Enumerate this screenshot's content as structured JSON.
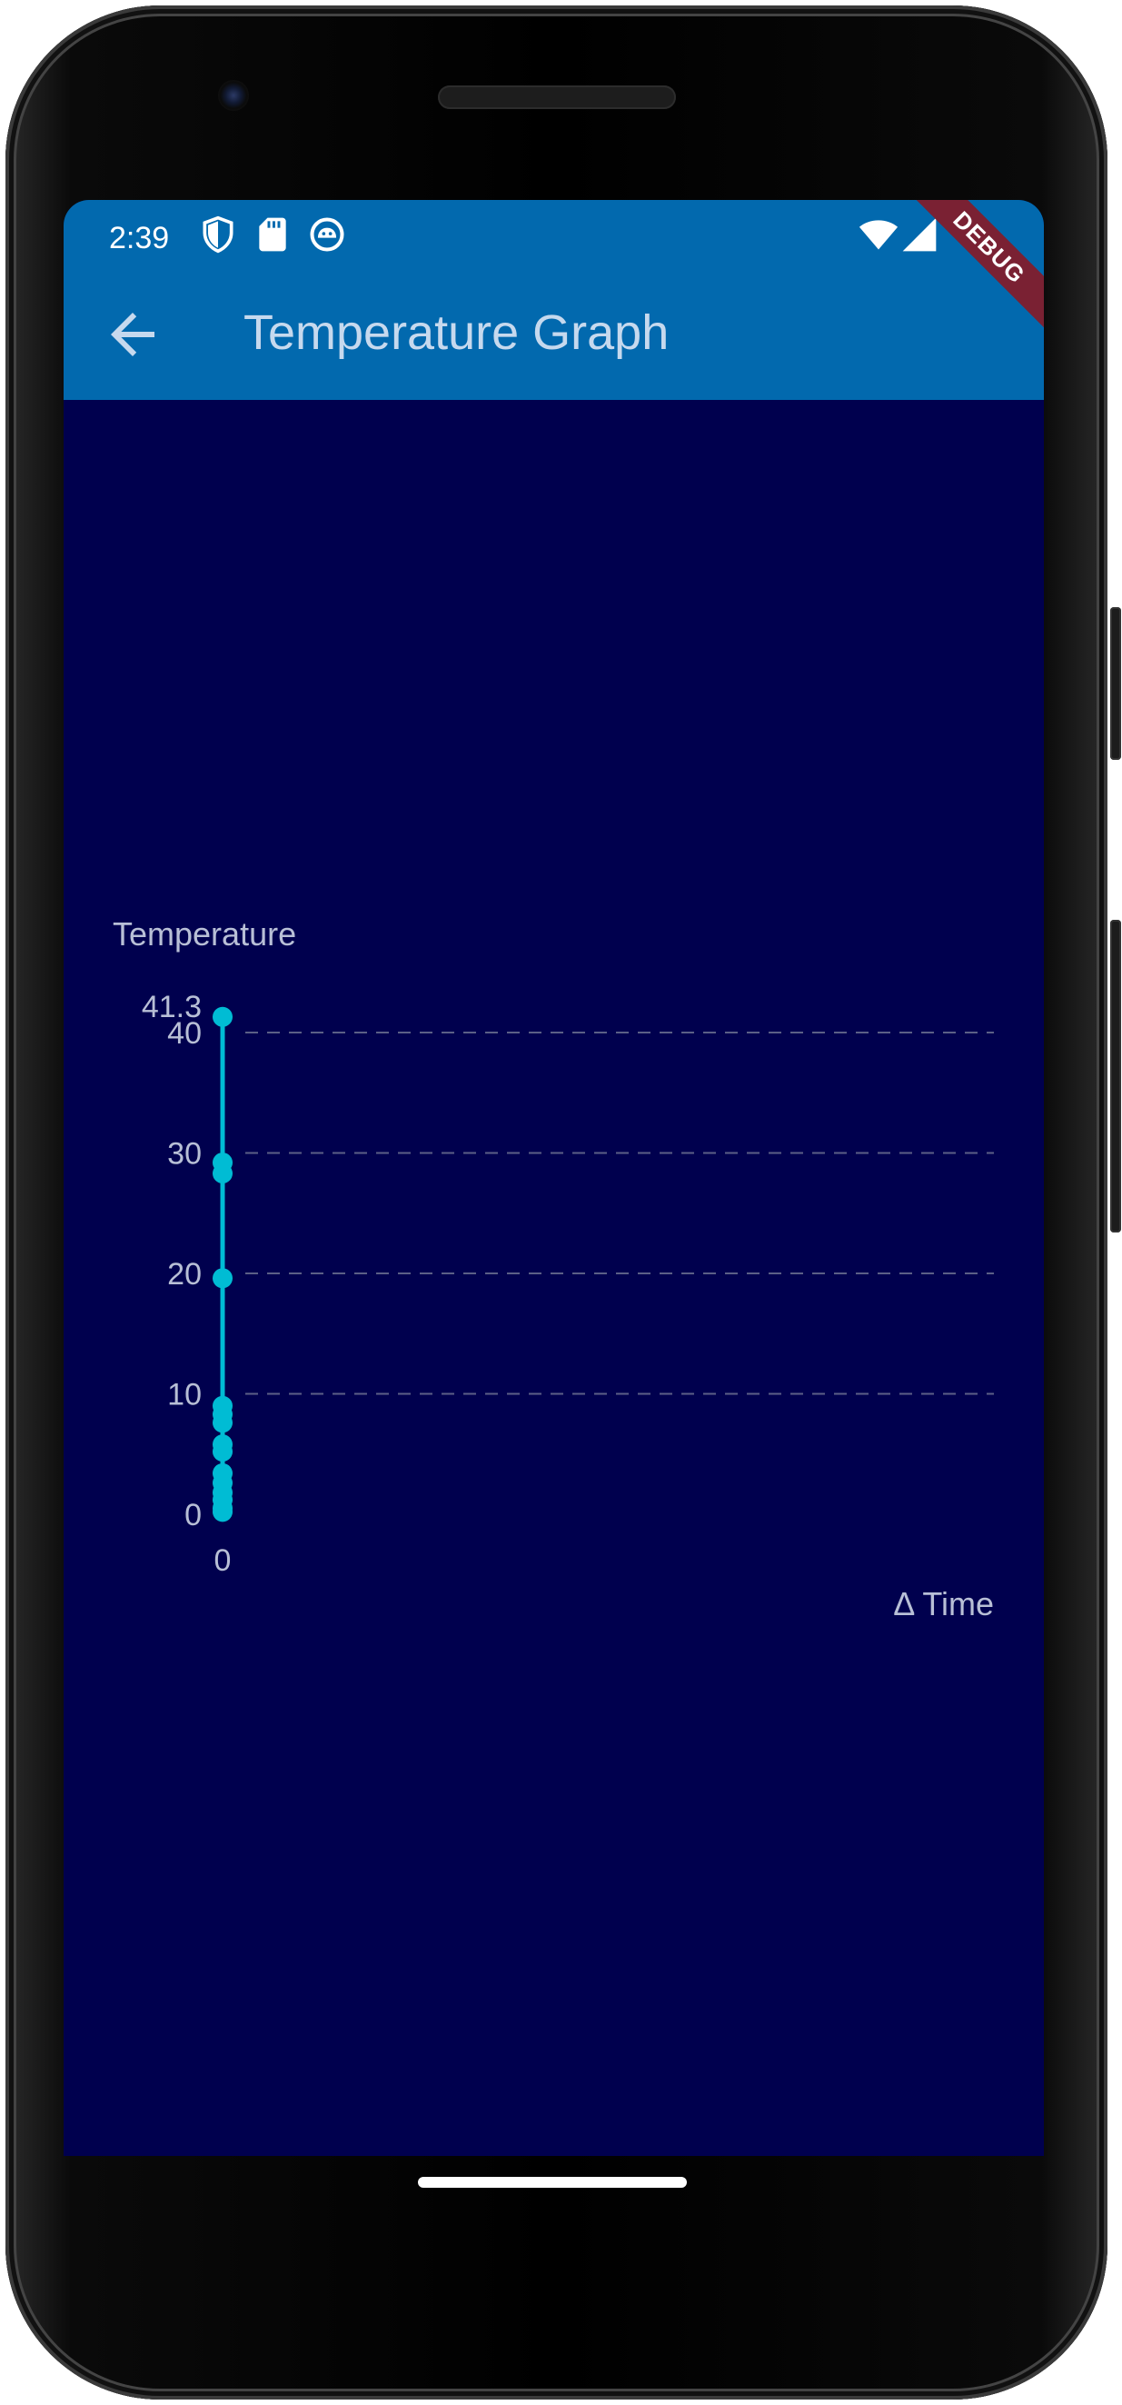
{
  "status_bar": {
    "time": "2:39",
    "icons_left": [
      "shield-icon",
      "sd-card-icon",
      "android-debug-icon"
    ],
    "icons_right": [
      "wifi-icon",
      "cell-signal-icon"
    ]
  },
  "app_bar": {
    "back_icon": "arrow-back-icon",
    "title": "Temperature Graph",
    "background": "#0269ae"
  },
  "debug_banner": {
    "label": "DEBUG",
    "color": "#7a2133"
  },
  "screen_background": "#00004e",
  "chart_data": {
    "type": "line",
    "ylabel": "Temperature",
    "xlabel": "Δ Time",
    "y_ticks": [
      "0",
      "10",
      "20",
      "30",
      "40"
    ],
    "y_max_label": "41.3",
    "x_ticks": [
      "0"
    ],
    "ylim": [
      0,
      41.3
    ],
    "grid": "horizontal-dashed",
    "line_color": "#00bcd4",
    "series": [
      {
        "x": [
          0,
          0,
          0,
          0,
          0,
          0,
          0,
          0,
          0,
          0,
          0,
          0,
          0,
          0,
          0
        ],
        "values": [
          41.3,
          29.2,
          28.3,
          19.6,
          9.0,
          8.3,
          7.6,
          5.8,
          5.2,
          3.4,
          2.6,
          1.8,
          1.2,
          0.5,
          0.2
        ]
      }
    ]
  }
}
